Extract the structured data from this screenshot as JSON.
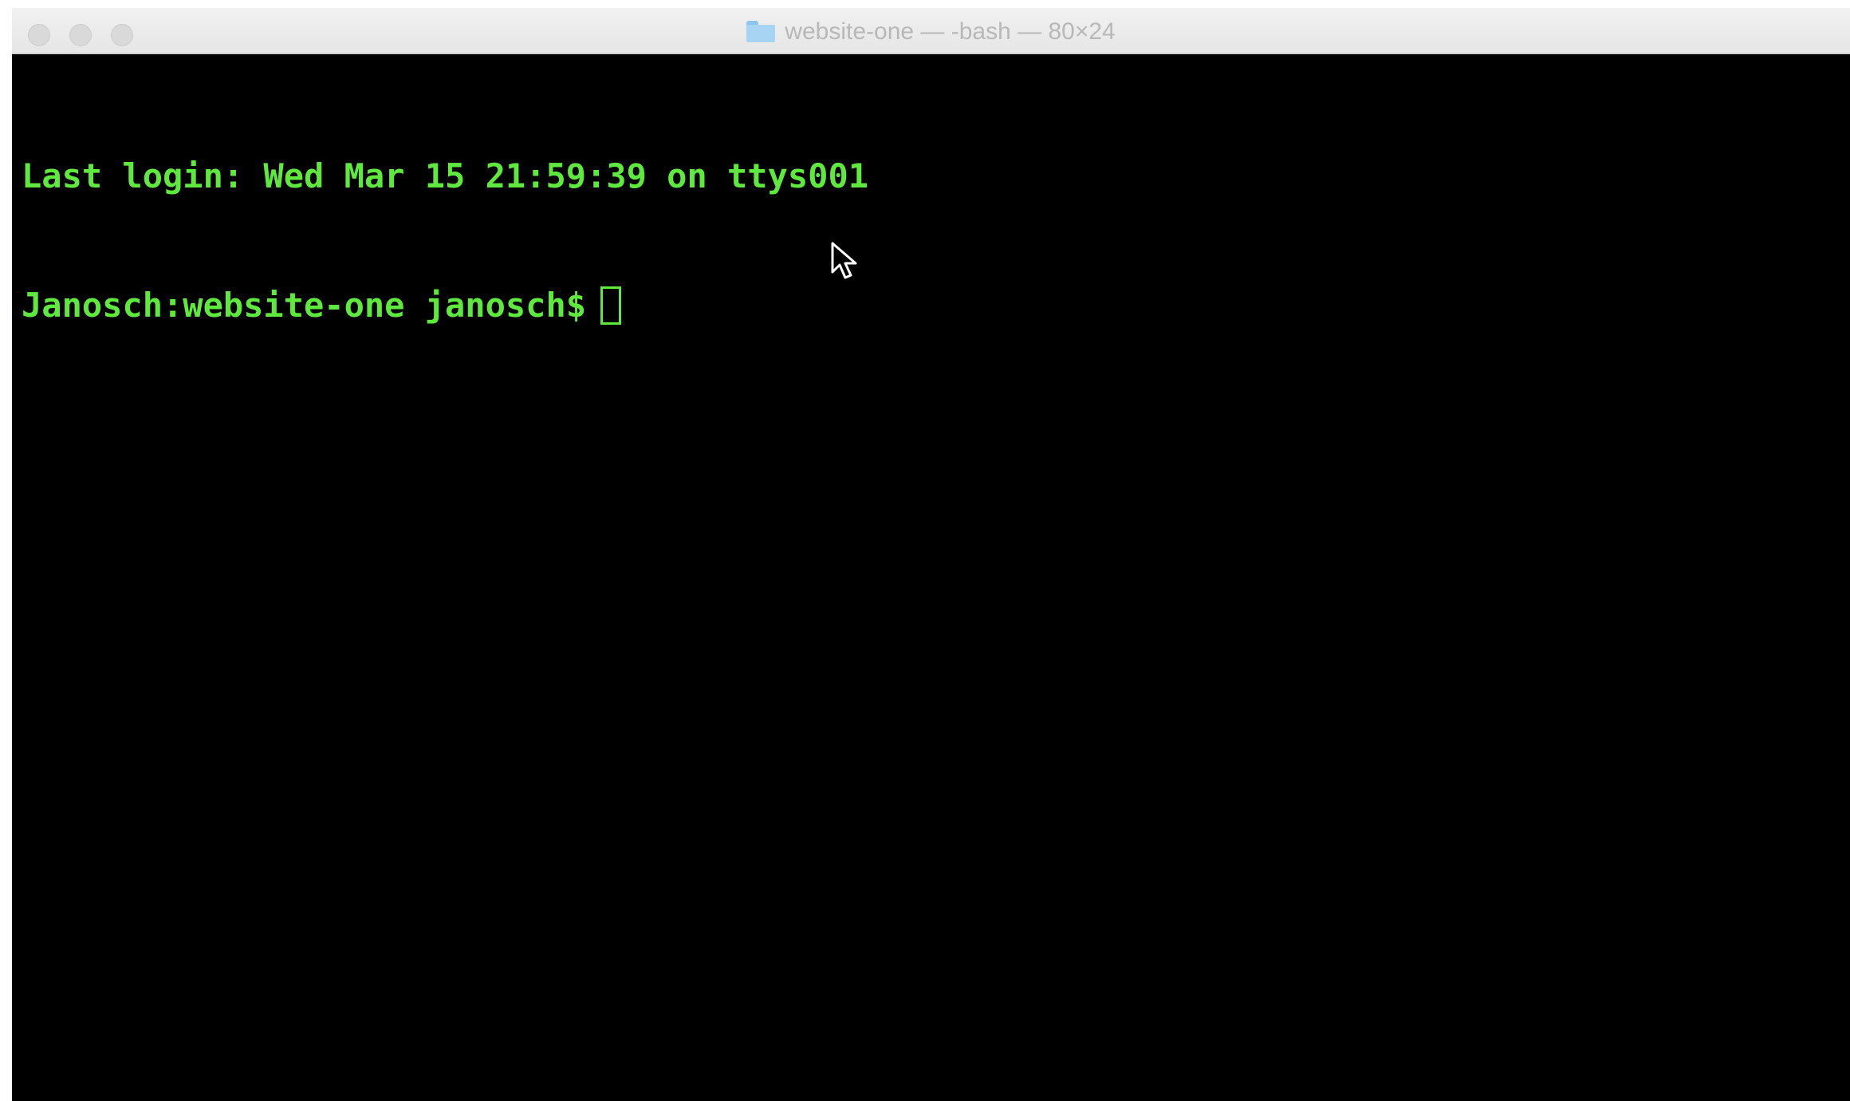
{
  "window": {
    "title": "website-one — -bash — 80×24",
    "folder_icon": "folder-icon"
  },
  "terminal": {
    "last_login": "Last login: Wed Mar 15 21:59:39 on ttys001",
    "prompt": "Janosch:website-one janosch$",
    "text_color": "#5fe93f",
    "background": "#000000"
  }
}
